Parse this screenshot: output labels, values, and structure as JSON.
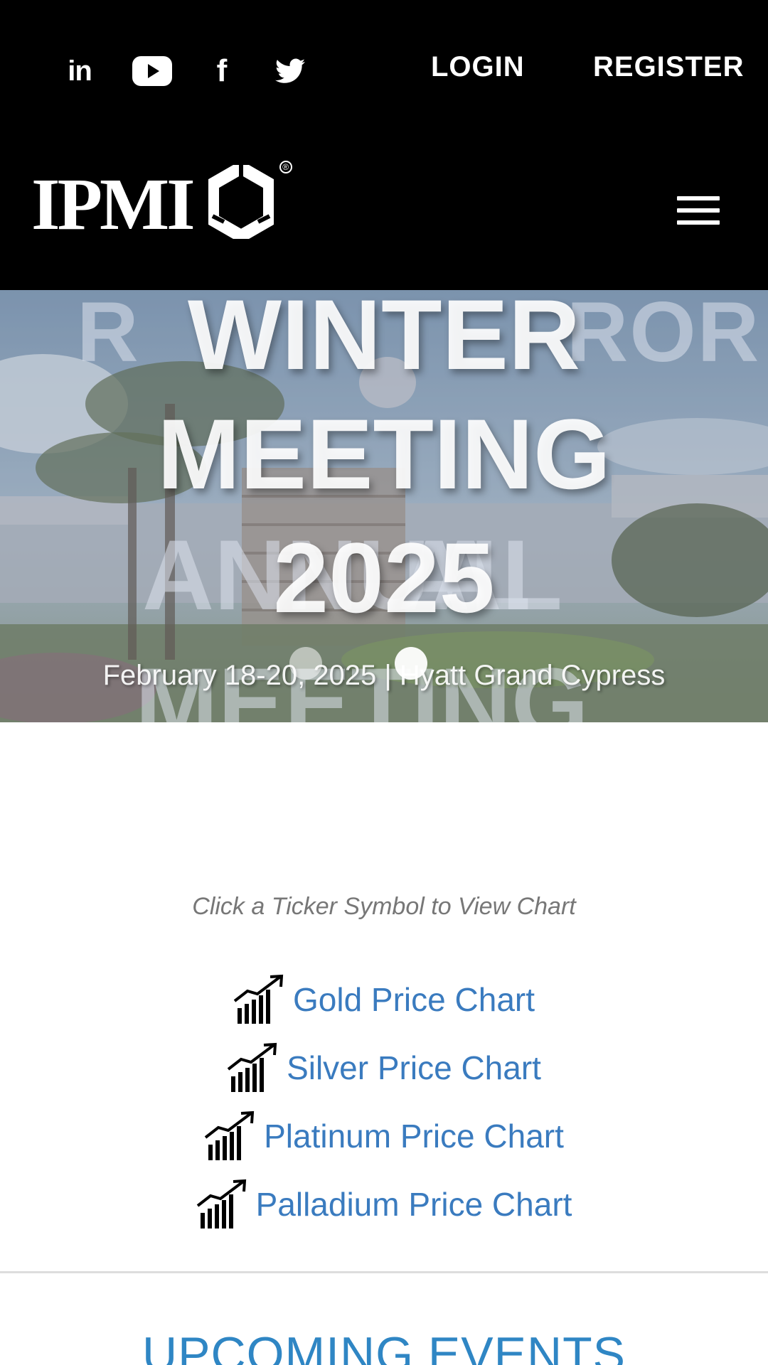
{
  "header": {
    "social": [
      {
        "icon": "linkedin-icon",
        "glyph": "in"
      },
      {
        "icon": "youtube-icon"
      },
      {
        "icon": "facebook-icon",
        "glyph": "f"
      },
      {
        "icon": "twitter-icon"
      }
    ],
    "login_label": "LOGIN",
    "register_label": "REGISTER",
    "logo_text": "IPMI",
    "registered_mark": "®",
    "menu_icon": "hamburger-menu-icon"
  },
  "hero": {
    "title_lines": [
      "WINTER",
      "MEETING",
      "2025"
    ],
    "subtitle": "February 18-20, 2025 | Hyatt Grand Cypress",
    "background_title_lines": [
      "ROR",
      "AL",
      "ANNUAL",
      "MEETING"
    ],
    "slides": 2,
    "active_slide": 2
  },
  "tickers": {
    "hint": "Click a Ticker Symbol to View Chart",
    "items": [
      {
        "label": "Gold Price Chart",
        "icon": "chart-growth-icon"
      },
      {
        "label": "Silver Price Chart",
        "icon": "chart-growth-icon"
      },
      {
        "label": "Platinum Price Chart",
        "icon": "chart-growth-icon"
      },
      {
        "label": "Palladium Price Chart",
        "icon": "chart-growth-icon"
      }
    ]
  },
  "events": {
    "heading": "UPCOMING EVENTS"
  },
  "colors": {
    "header_bg": "#000000",
    "link": "#3a7bbf",
    "heading_blue": "#2f86c4",
    "hint_gray": "#777777"
  }
}
